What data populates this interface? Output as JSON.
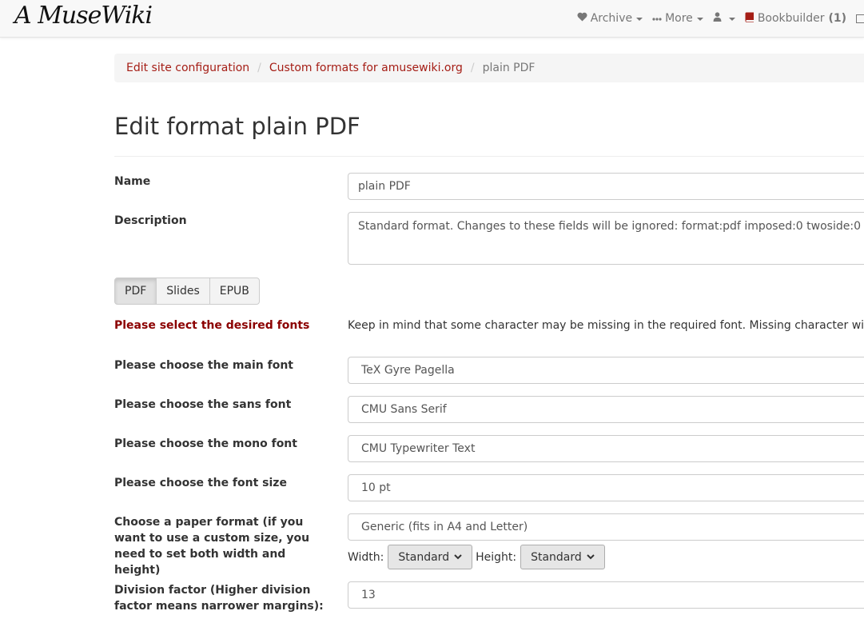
{
  "nav": {
    "logo": "A MuseWiki",
    "archive": "Archive",
    "more": "More",
    "bookbuilder": "Bookbuilder",
    "bookbuilder_count": "(1)"
  },
  "breadcrumb": {
    "items": [
      "Edit site configuration",
      "Custom formats for amusewiki.org"
    ],
    "active": "plain PDF"
  },
  "page": {
    "title": "Edit format plain PDF"
  },
  "form": {
    "name_label": "Name",
    "name_value": "plain PDF",
    "description_label": "Description",
    "description_value": "Standard format. Changes to these fields will be ignored: format:pdf imposed:0 twoside:0",
    "tabs": [
      "PDF",
      "Slides",
      "EPUB"
    ],
    "fonts_heading": "Please select the desired fonts",
    "fonts_help": "Keep in mind that some character may be missing in the required font. Missing character will be",
    "main_font_label": "Please choose the main font",
    "main_font_value": "TeX Gyre Pagella",
    "sans_font_label": "Please choose the sans font",
    "sans_font_value": "CMU Sans Serif",
    "mono_font_label": "Please choose the mono font",
    "mono_font_value": "CMU Typewriter Text",
    "font_size_label": "Please choose the font size",
    "font_size_value": "10 pt",
    "paper_label": "Choose a paper format (if you want to use a custom size, you need to set both width and height)",
    "paper_value": "Generic (fits in A4 and Letter)",
    "width_label": "Width:",
    "width_value": "Standard",
    "height_label": "Height:",
    "height_value": "Standard",
    "division_label": "Division factor (Higher division factor means narrower margins):",
    "division_value": "13"
  }
}
